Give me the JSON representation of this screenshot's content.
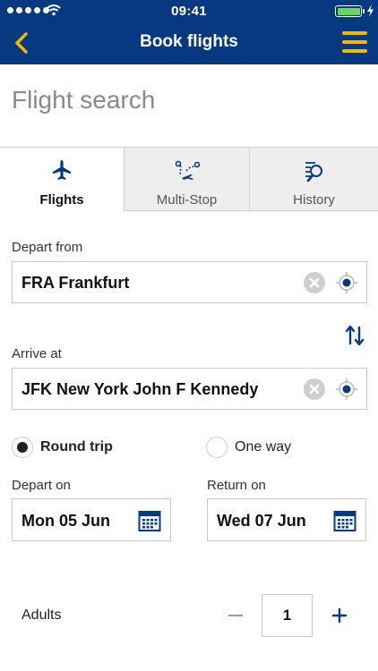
{
  "status_bar": {
    "time": "09:41"
  },
  "nav": {
    "title": "Book flights"
  },
  "page_title": "Flight search",
  "tabs": [
    {
      "label": "Flights",
      "icon": "airplane-icon",
      "selected": true
    },
    {
      "label": "Multi-Stop",
      "icon": "multi-stop-route-icon",
      "selected": false
    },
    {
      "label": "History",
      "icon": "history-search-icon",
      "selected": false
    }
  ],
  "depart_from": {
    "label": "Depart from",
    "value": "FRA Frankfurt"
  },
  "arrive_at": {
    "label": "Arrive at",
    "value": "JFK New York John F Kennedy"
  },
  "trip_type": {
    "options": [
      {
        "label": "Round trip",
        "selected": true
      },
      {
        "label": "One way",
        "selected": false
      }
    ]
  },
  "depart_on": {
    "label": "Depart on",
    "value": "Mon 05 Jun"
  },
  "return_on": {
    "label": "Return on",
    "value": "Wed 07 Jun"
  },
  "adults": {
    "label": "Adults",
    "count": "1"
  },
  "colors": {
    "brand_blue": "#06397f",
    "accent_yellow": "#f5b800",
    "battery_green": "#6ad36a"
  }
}
